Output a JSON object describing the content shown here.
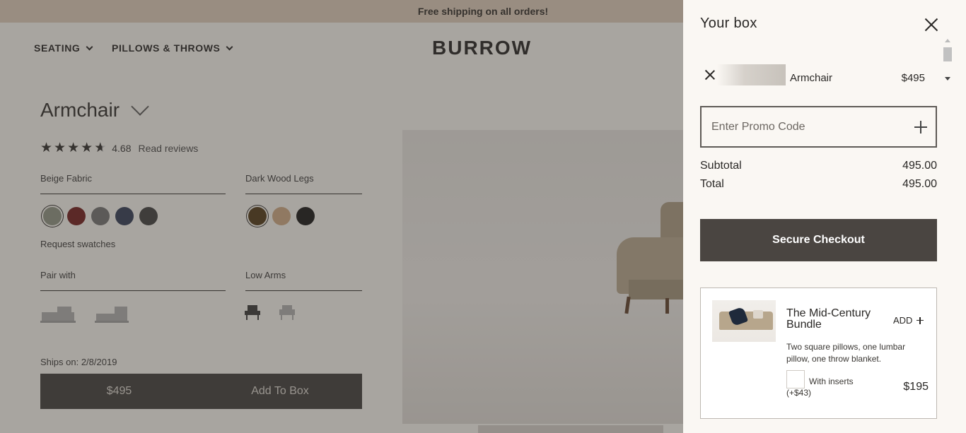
{
  "promo_bar": {
    "text": "Free shipping on all orders!"
  },
  "nav": {
    "items": [
      {
        "label": "SEATING"
      },
      {
        "label": "PILLOWS & THROWS"
      }
    ],
    "logo": "BURROW"
  },
  "product": {
    "title": "Armchair",
    "rating": "4.68",
    "reviews_link": "Read reviews",
    "stars_filled": 4.68,
    "fabric": {
      "label": "Beige Fabric",
      "swatches": [
        "#8a8f7f",
        "#6b1616",
        "#6d6d6d",
        "#2c3650",
        "#3a3a3a"
      ],
      "selected_index": 0
    },
    "legs": {
      "label": "Dark Wood Legs",
      "swatches": [
        "#4a3210",
        "#c9a57f",
        "#111111"
      ],
      "selected_index": 0
    },
    "request_swatches": "Request swatches",
    "pair_with": {
      "label": "Pair with"
    },
    "arms": {
      "label": "Low Arms"
    },
    "ships_on": "Ships on: 2/8/2019",
    "add_bar": {
      "price": "$495",
      "label": "Add To Box"
    }
  },
  "cart": {
    "title": "Your box",
    "line_items": [
      {
        "name": "Armchair",
        "price": "$495"
      }
    ],
    "promo": {
      "placeholder": "Enter Promo Code",
      "value": ""
    },
    "subtotal": {
      "label": "Subtotal",
      "value": "495.00"
    },
    "total": {
      "label": "Total",
      "value": "495.00"
    },
    "checkout_label": "Secure Checkout",
    "upsell": {
      "title": "The Mid-Century Bundle",
      "add_label": "ADD",
      "description": "Two square pillows, one lumbar pillow, one throw blanket.",
      "inserts_label": "With inserts",
      "inserts_price": "(+$43)",
      "price": "$195"
    }
  },
  "colors": {
    "accent_dark": "#4a4541",
    "promo_bar_bg": "#d9c8b6",
    "drawer_bg": "#faf7f3"
  }
}
